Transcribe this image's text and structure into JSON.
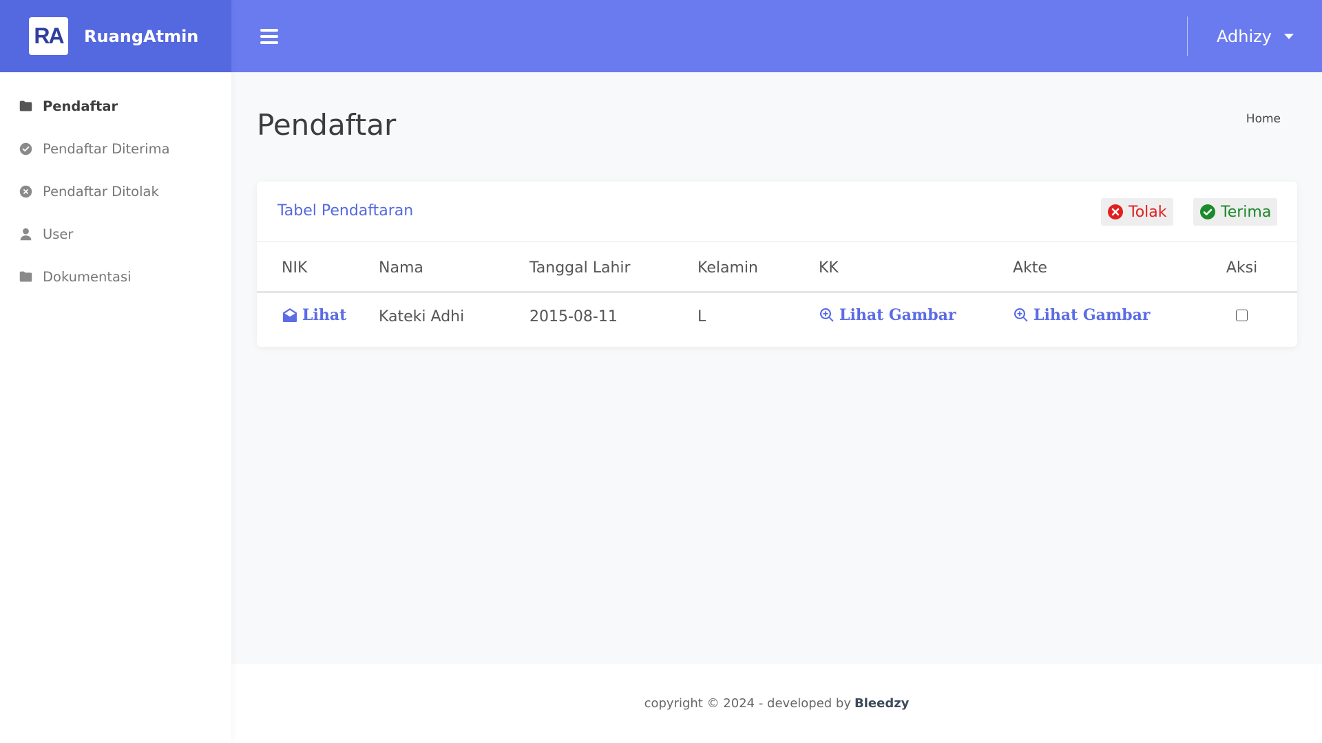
{
  "brand": {
    "logo_text": "RA",
    "name": "RuangAtmin"
  },
  "sidebar": {
    "items": [
      {
        "label": "Pendaftar",
        "icon": "folder-icon"
      },
      {
        "label": "Pendaftar Diterima",
        "icon": "check-circle-icon"
      },
      {
        "label": "Pendaftar Ditolak",
        "icon": "x-circle-icon"
      },
      {
        "label": "User",
        "icon": "user-icon"
      },
      {
        "label": "Dokumentasi",
        "icon": "folder-icon"
      }
    ]
  },
  "topbar": {
    "user_name": "Adhizy"
  },
  "page": {
    "title": "Pendaftar",
    "breadcrumb": "Home"
  },
  "card": {
    "title": "Tabel Pendaftaran",
    "tolak_label": "Tolak",
    "terima_label": "Terima"
  },
  "table": {
    "headers": [
      "NIK",
      "Nama",
      "Tanggal Lahir",
      "Kelamin",
      "KK",
      "Akte",
      "Aksi"
    ],
    "rows": [
      {
        "nik": "Lihat",
        "nama": "Kateki Adhi",
        "tanggal_lahir": "2015-08-11",
        "kelamin": "L",
        "kk": "Lihat Gambar",
        "akte": "Lihat Gambar"
      }
    ]
  },
  "footer": {
    "text": "copyright © 2024 - developed by",
    "author": "Bleedzy"
  },
  "colors": {
    "brand_bg": "#5468e0",
    "topbar_bg": "#6a7bef",
    "accent": "#5b6ce6",
    "danger": "#e02020",
    "success": "#1a8a2a"
  }
}
